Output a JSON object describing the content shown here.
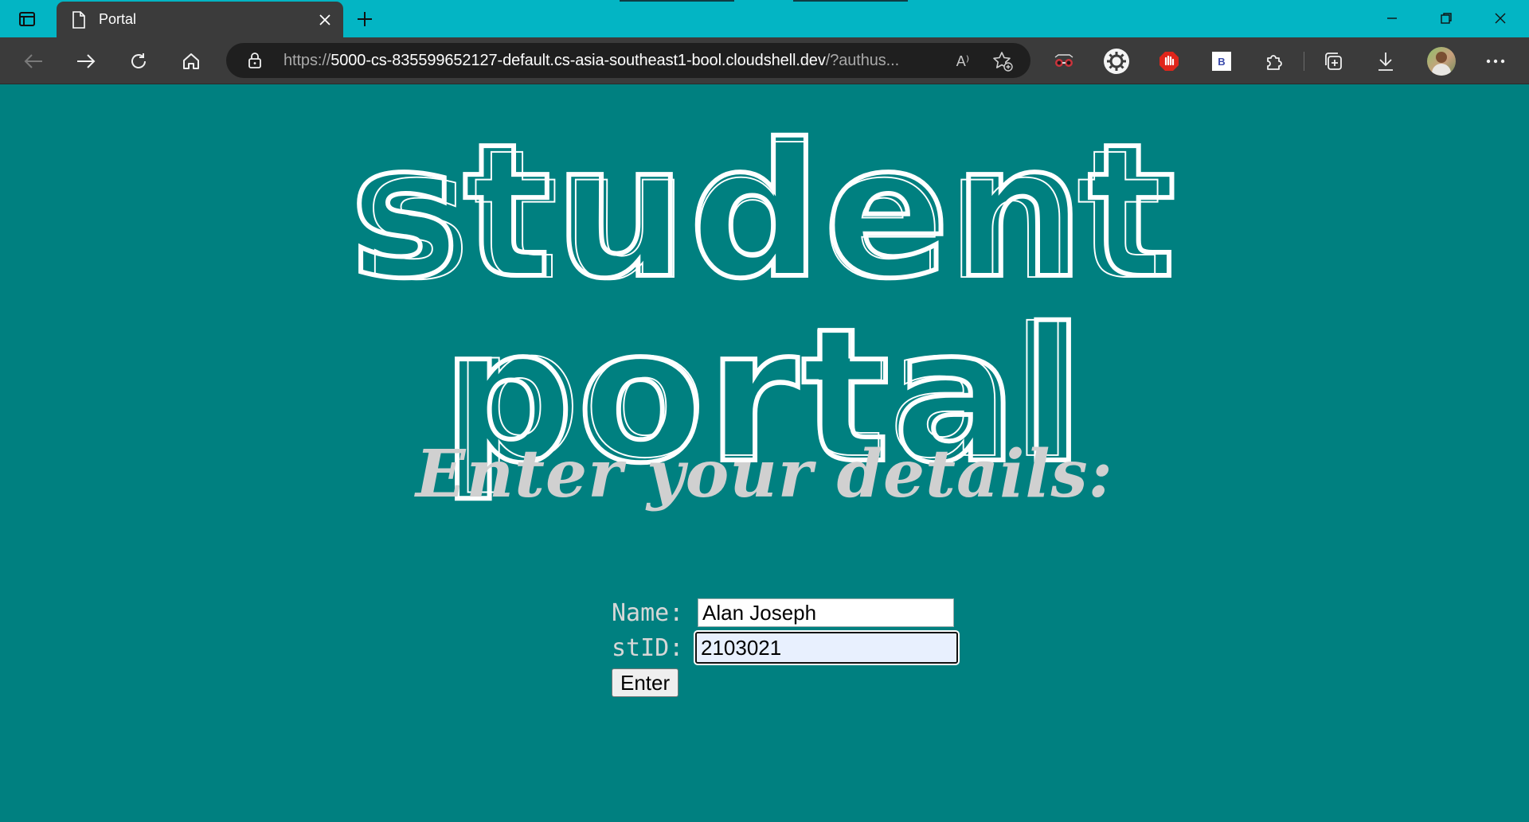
{
  "browser": {
    "tab": {
      "title": "Portal"
    },
    "address": {
      "protocol": "https://",
      "host": "5000-cs-835599652127-default.cs-asia-southeast1-bool.cloudshell.dev",
      "query": "/?authus..."
    },
    "read_aloud_glyph": "A⁾",
    "extension_badge": "B"
  },
  "page": {
    "title": "student portal",
    "subtitle": "Enter your details:",
    "form": {
      "name_label": "Name:",
      "name_value": "Alan Joseph",
      "stid_label": "stID:",
      "stid_value": "2103021",
      "submit_label": "Enter"
    }
  },
  "colors": {
    "page_background": "#008080",
    "title_bar": "#03b5c4",
    "toolbar": "#3b3b3b",
    "title_text": "#ffffff",
    "subtitle_text": "#d0d0d0"
  }
}
